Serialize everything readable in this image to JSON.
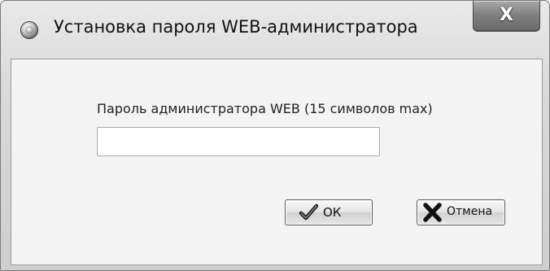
{
  "window": {
    "title": "Установка пароля WEB-администратора",
    "close_symbol": "X"
  },
  "form": {
    "password_label": "Пароль администратора WEB (15 символов max)",
    "password_value": "",
    "password_placeholder": ""
  },
  "buttons": {
    "ok_label": "ОК",
    "ok_icon": "checkmark-icon",
    "cancel_label": "Отмена",
    "cancel_icon": "cross-icon"
  },
  "icons": {
    "app_icon": "disc-icon"
  }
}
